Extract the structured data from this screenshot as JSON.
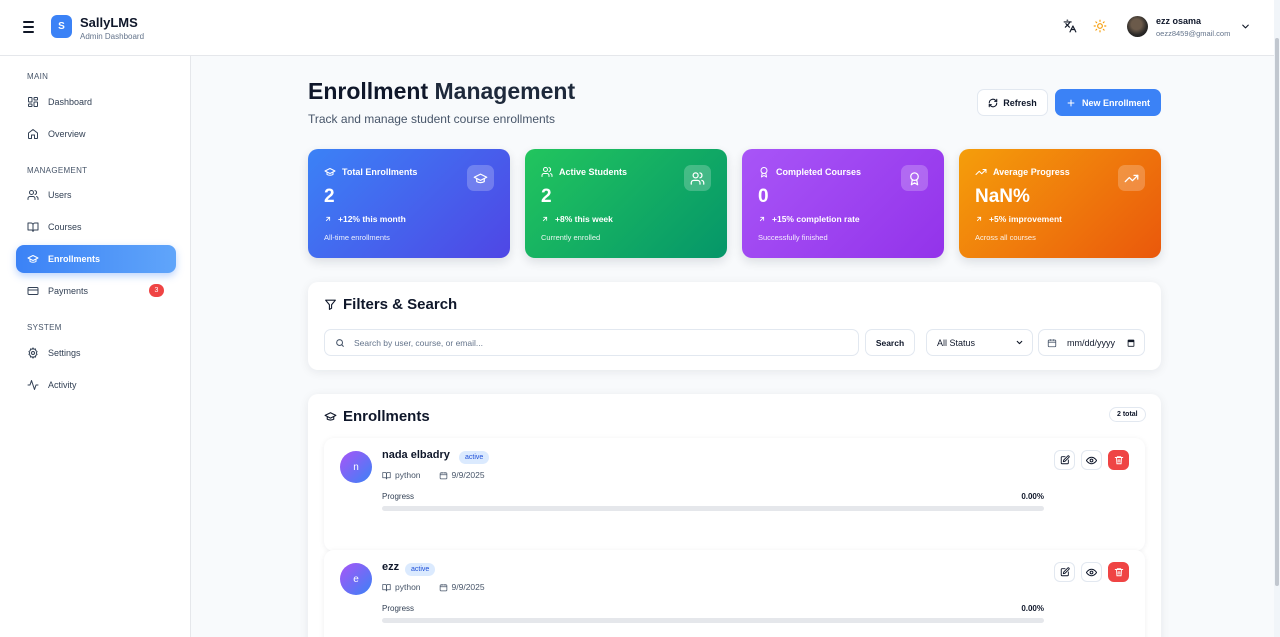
{
  "app": {
    "logo_letter": "S",
    "name": "SallyLMS",
    "subtitle": "Admin Dashboard"
  },
  "user": {
    "name": "ezz osama",
    "email": "oezz8459@gmail.com"
  },
  "sidebar": {
    "sections": [
      {
        "label": "MAIN"
      },
      {
        "label": "MANAGEMENT"
      },
      {
        "label": "SYSTEM"
      }
    ],
    "items": [
      {
        "label": "Dashboard"
      },
      {
        "label": "Overview"
      },
      {
        "label": "Users"
      },
      {
        "label": "Courses"
      },
      {
        "label": "Enrollments",
        "active": true
      },
      {
        "label": "Payments",
        "badge": "3"
      },
      {
        "label": "Settings"
      },
      {
        "label": "Activity"
      }
    ]
  },
  "page": {
    "title_part1": "Enrollment",
    "title_part2": "Management",
    "subtitle": "Track and manage student course enrollments",
    "refresh_label": "Refresh",
    "new_label": "New Enrollment"
  },
  "stats": [
    {
      "title": "Total Enrollments",
      "value": "2",
      "change": "+12% this month",
      "note": "All-time enrollments",
      "color_from": "#3b82f6",
      "color_to": "#4f46e5",
      "icon": "graduation-cap-icon"
    },
    {
      "title": "Active Students",
      "value": "2",
      "change": "+8% this week",
      "note": "Currently enrolled",
      "color_from": "#22c55e",
      "color_to": "#059669",
      "icon": "users-icon"
    },
    {
      "title": "Completed Courses",
      "value": "0",
      "change": "+15% completion rate",
      "note": "Successfully finished",
      "color_from": "#a855f7",
      "color_to": "#9333ea",
      "icon": "award-icon"
    },
    {
      "title": "Average Progress",
      "value": "NaN%",
      "change": "+5% improvement",
      "note": "Across all courses",
      "color_from": "#f59e0b",
      "color_to": "#ea580c",
      "icon": "trending-up-icon"
    }
  ],
  "filters": {
    "title": "Filters & Search",
    "search_placeholder": "Search by user, course, or email...",
    "search_button": "Search",
    "status_selected": "All Status",
    "date_placeholder": "mm/dd/yyyy"
  },
  "enrollments": {
    "title": "Enrollments",
    "total_label": "2 total",
    "rows": [
      {
        "initial": "n",
        "name": "nada elbadry",
        "status": "active",
        "course": "python",
        "date": "9/9/2025",
        "progress_label": "Progress",
        "progress_text": "0.00%",
        "progress": 0
      },
      {
        "initial": "e",
        "name": "ezz",
        "status": "active",
        "course": "python",
        "date": "9/9/2025",
        "progress_label": "Progress",
        "progress_text": "0.00%",
        "progress": 0
      }
    ]
  }
}
